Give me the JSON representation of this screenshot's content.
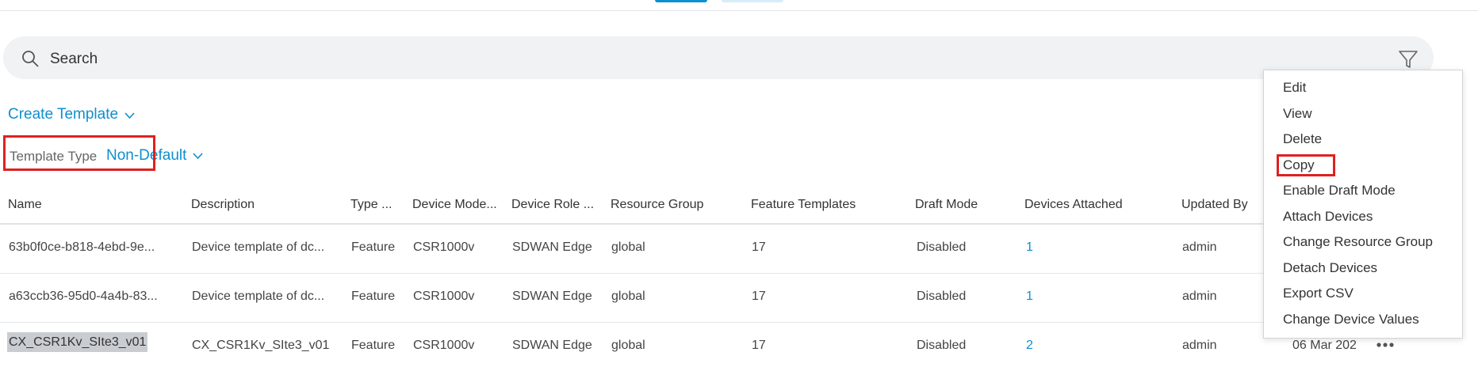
{
  "search": {
    "placeholder": "Search"
  },
  "toolbar": {
    "create_template_label": "Create Template"
  },
  "filter": {
    "template_type_label": "Template Type",
    "template_type_value": "Non-Default"
  },
  "table": {
    "headers": [
      "Name",
      "Description",
      "Type ...",
      "Device Mode...",
      "Device Role ...",
      "Resource Group",
      "Feature Templates",
      "Draft Mode",
      "Devices Attached",
      "Updated By"
    ],
    "rows": [
      [
        "63b0f0ce-b818-4ebd-9e...",
        "Device template of dc...",
        "Feature",
        "CSR1000v",
        "SDWAN Edge",
        "global",
        "17",
        "Disabled",
        "1",
        "admin"
      ],
      [
        "a63ccb36-95d0-4a4b-83...",
        "Device template of dc...",
        "Feature",
        "CSR1000v",
        "SDWAN Edge",
        "global",
        "17",
        "Disabled",
        "1",
        "admin"
      ],
      [
        "CX_CSR1Kv_SIte3_v01",
        "CX_CSR1Kv_SIte3_v01",
        "Feature",
        "CSR1000v",
        "SDWAN Edge",
        "global",
        "17",
        "Disabled",
        "2",
        "admin"
      ]
    ],
    "partial_updated_on": "06 Mar 202"
  },
  "context_menu": {
    "items": [
      "Edit",
      "View",
      "Delete",
      "Copy",
      "Enable Draft Mode",
      "Attach Devices",
      "Change Resource Group",
      "Detach Devices",
      "Export CSV",
      "Change Device Values"
    ]
  },
  "colors": {
    "accent": "#0d8fcf",
    "highlight_border": "#e02020"
  },
  "icons": {
    "search": "search-icon",
    "filter": "filter-icon",
    "chevron": "chevron-down-icon",
    "more": "more-options-icon"
  }
}
